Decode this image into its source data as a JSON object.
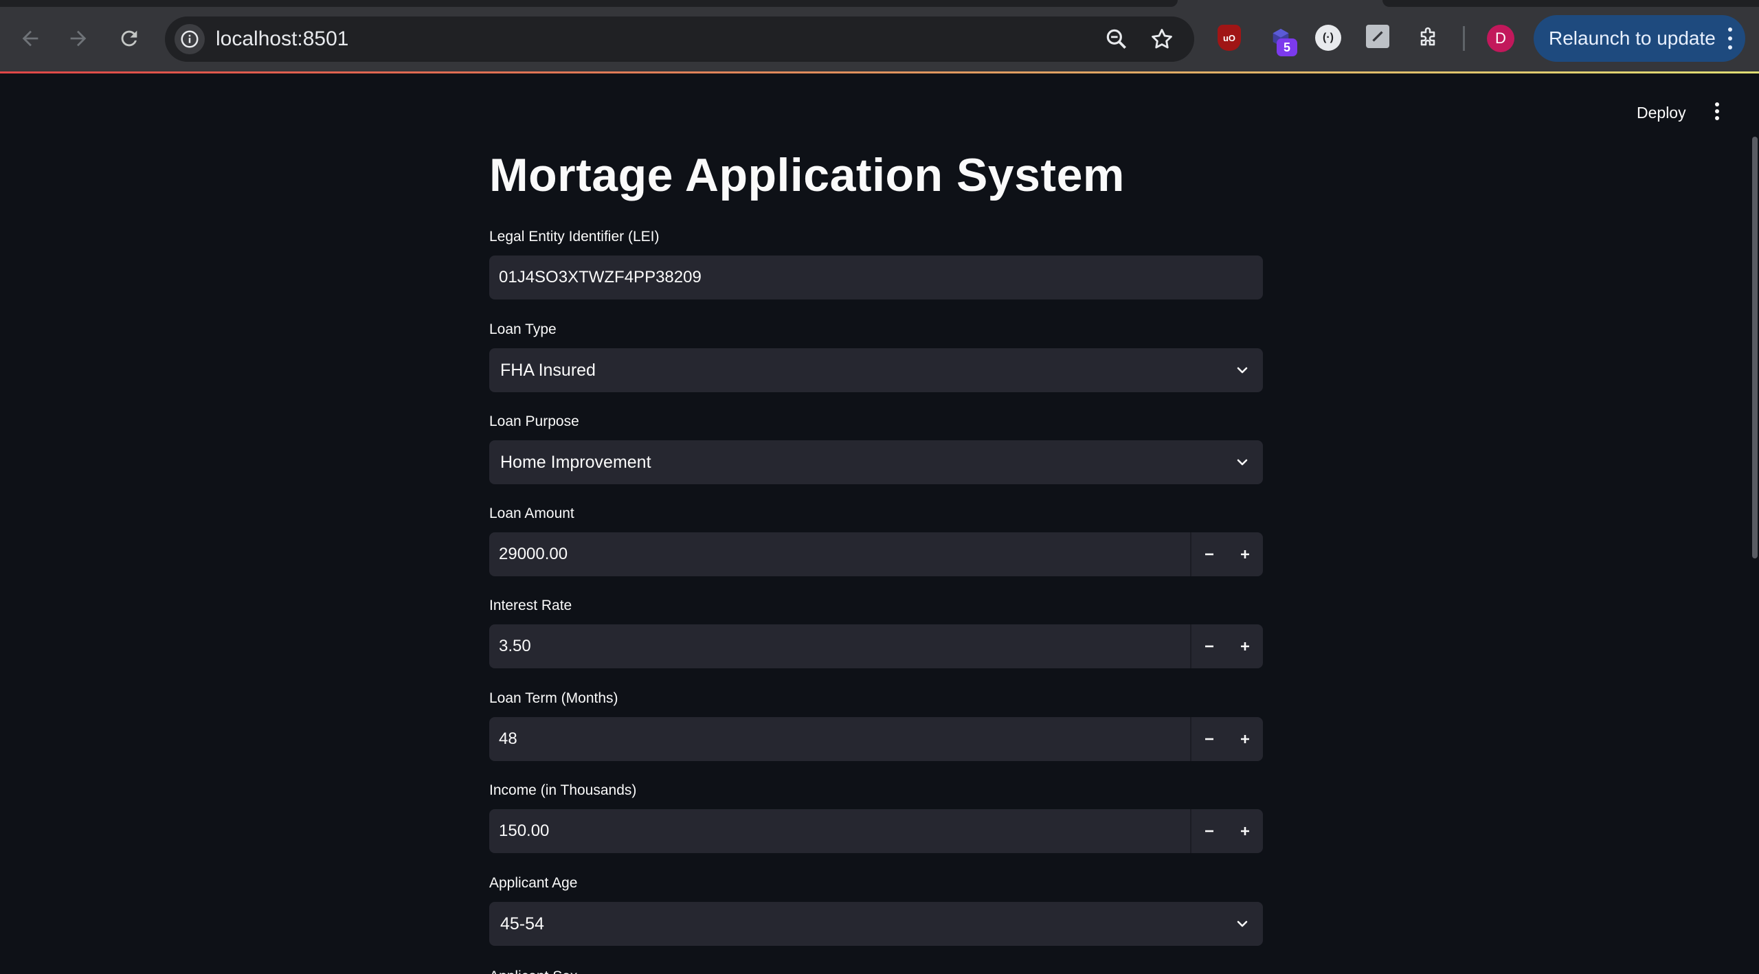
{
  "browser": {
    "url": "localhost:8501",
    "relaunch_label": "Relaunch to update",
    "profile_initial": "D",
    "extension_badge_count": "5",
    "extensions": [
      "ublock-origin-icon",
      "extension-hex-icon",
      "extension-circle-icon",
      "extension-note-icon",
      "extensions-puzzle-icon"
    ]
  },
  "app": {
    "deploy_label": "Deploy",
    "title": "Mortage Application System"
  },
  "form": {
    "lei": {
      "label": "Legal Entity Identifier (LEI)",
      "value": "01J4SO3XTWZF4PP38209"
    },
    "loan_type": {
      "label": "Loan Type",
      "value": "FHA Insured"
    },
    "loan_purpose": {
      "label": "Loan Purpose",
      "value": "Home Improvement"
    },
    "loan_amount": {
      "label": "Loan Amount",
      "value": "29000.00"
    },
    "interest_rate": {
      "label": "Interest Rate",
      "value": "3.50"
    },
    "loan_term": {
      "label": "Loan Term (Months)",
      "value": "48"
    },
    "income": {
      "label": "Income (in Thousands)",
      "value": "150.00"
    },
    "applicant_age": {
      "label": "Applicant Age",
      "value": "45-54"
    },
    "applicant_sex": {
      "label": "Applicant Sex"
    }
  },
  "colors": {
    "app_background": "#0e1117",
    "input_background": "#262730",
    "chrome_toolbar": "#35363a",
    "relaunch_button": "#1e4a7e",
    "profile_avatar": "#c2185b"
  }
}
